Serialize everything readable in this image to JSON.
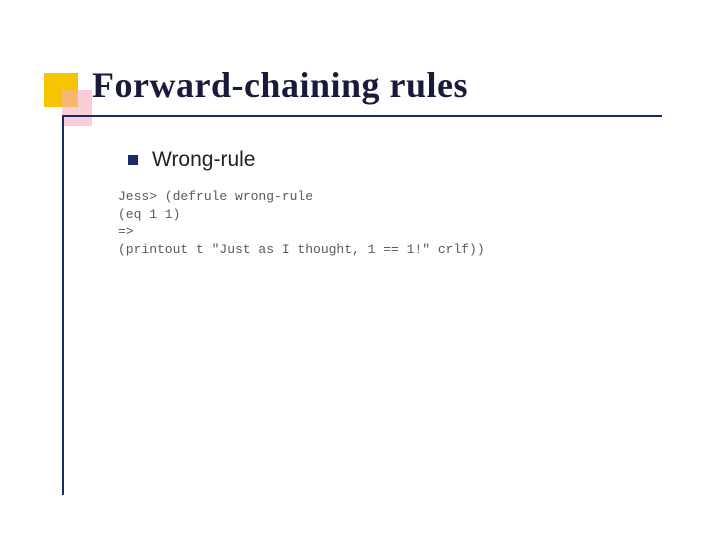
{
  "title": "Forward-chaining rules",
  "bullet": {
    "label": "Wrong-rule"
  },
  "code": {
    "line1": "Jess> (defrule wrong-rule",
    "line2": "(eq 1 1)",
    "line3": "=>",
    "line4": "(printout t \"Just as I thought, 1 == 1!\" crlf))"
  }
}
